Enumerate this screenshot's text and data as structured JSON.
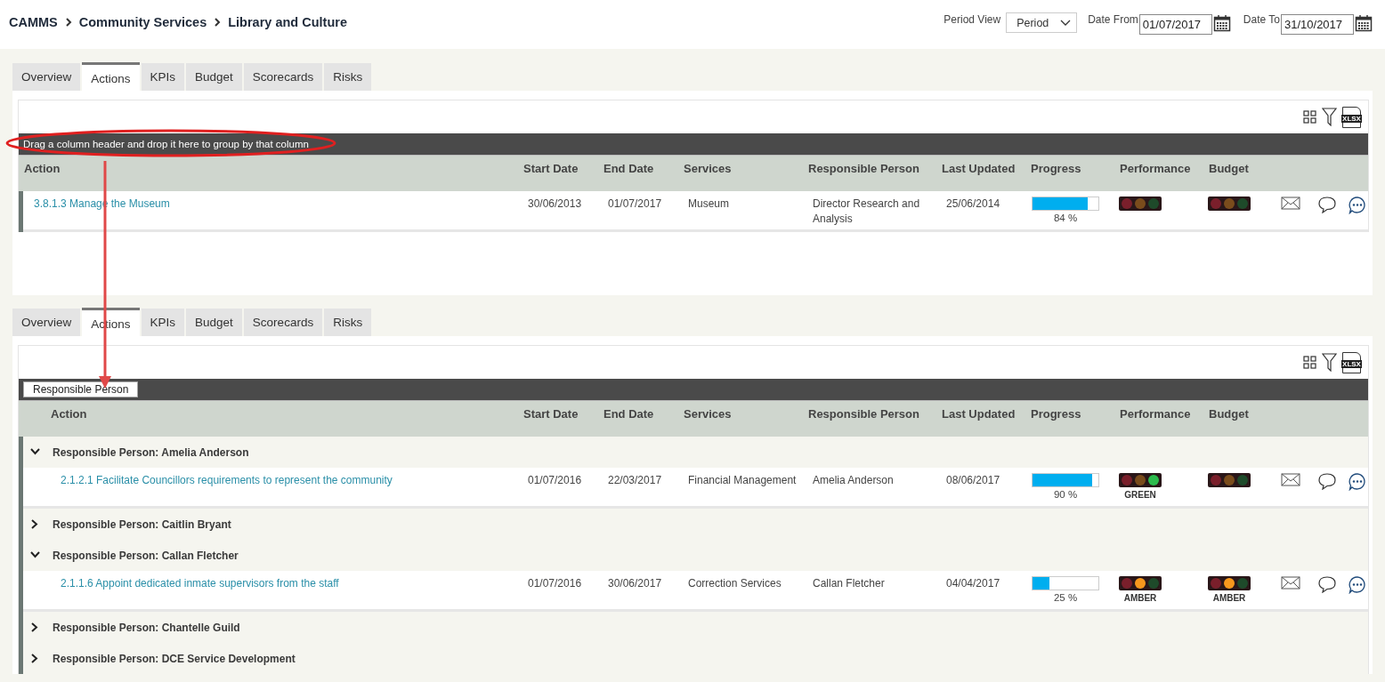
{
  "breadcrumb": [
    "CAMMS",
    "Community Services",
    "Library and Culture"
  ],
  "filters": {
    "period_view": {
      "label": "Period View",
      "value": "Period"
    },
    "date_from": {
      "label": "Date From",
      "value": "01/07/2017"
    },
    "date_to": {
      "label": "Date To",
      "value": "31/10/2017"
    }
  },
  "panels": [
    {
      "tabs": [
        {
          "label": "Overview",
          "selected": false
        },
        {
          "label": "Actions",
          "selected": true
        },
        {
          "label": "KPIs",
          "selected": false
        },
        {
          "label": "Budget",
          "selected": false
        },
        {
          "label": "Scorecards",
          "selected": false
        },
        {
          "label": "Risks",
          "selected": false
        }
      ],
      "export_label": "XLSX",
      "group_bar": {
        "kind": "hint",
        "text": "Drag a column header and drop it here to group by that column"
      },
      "columns": [
        "Action",
        "Start Date",
        "End Date",
        "Services",
        "Responsible Person",
        "Last Updated",
        "Progress",
        "Performance",
        "Budget"
      ],
      "rows": [
        {
          "action": "3.8.1.3 Manage the Museum",
          "start_date": "30/06/2013",
          "end_date": "01/07/2017",
          "service": "Museum",
          "responsible_person": "Director Research and Analysis",
          "last_updated": "25/06/2014",
          "progress": {
            "level": 0.84,
            "reading": "84 %"
          },
          "performance": {
            "lit": {
              "red": false,
              "amber": false,
              "green": false
            }
          },
          "budget": {
            "lit": {
              "red": false,
              "amber": false,
              "green": false
            }
          }
        }
      ]
    },
    {
      "tabs": [
        {
          "label": "Overview",
          "selected": false
        },
        {
          "label": "Actions",
          "selected": true
        },
        {
          "label": "KPIs",
          "selected": false
        },
        {
          "label": "Budget",
          "selected": false
        },
        {
          "label": "Scorecards",
          "selected": false
        },
        {
          "label": "Risks",
          "selected": false
        }
      ],
      "export_label": "XLSX",
      "group_bar": {
        "kind": "chips",
        "chips": [
          "Responsible Person"
        ]
      },
      "columns": [
        "Action",
        "Start Date",
        "End Date",
        "Services",
        "Responsible Person",
        "Last Updated",
        "Progress",
        "Performance",
        "Budget"
      ],
      "groups": [
        {
          "label": "Responsible Person: Amelia Anderson",
          "expanded": true,
          "children": [
            {
              "action": "2.1.2.1 Facilitate Councillors requirements to represent the community",
              "start_date": "01/07/2016",
              "end_date": "22/03/2017",
              "service": "Financial Management",
              "responsible_person": "Amelia Anderson",
              "last_updated": "08/06/2017",
              "progress": {
                "level": 0.9,
                "reading": "90 %"
              },
              "performance": {
                "lit": {
                  "red": false,
                  "amber": false,
                  "green": true
                },
                "label": "GREEN"
              },
              "budget": {
                "lit": {
                  "red": false,
                  "amber": false,
                  "green": false
                }
              }
            }
          ]
        },
        {
          "label": "Responsible Person: Caitlin Bryant",
          "expanded": false
        },
        {
          "label": "Responsible Person: Callan Fletcher",
          "expanded": true,
          "children": [
            {
              "action": "2.1.1.6 Appoint dedicated inmate supervisors from the staff",
              "start_date": "01/07/2016",
              "end_date": "30/06/2017",
              "service": "Correction Services",
              "responsible_person": "Callan Fletcher",
              "last_updated": "04/04/2017",
              "progress": {
                "level": 0.25,
                "reading": "25 %"
              },
              "performance": {
                "lit": {
                  "red": false,
                  "amber": true,
                  "green": false
                },
                "label": "AMBER"
              },
              "budget": {
                "lit": {
                  "red": false,
                  "amber": true,
                  "green": false
                },
                "label": "AMBER"
              }
            }
          ]
        },
        {
          "label": "Responsible Person: Chantelle Guild",
          "expanded": false
        },
        {
          "label": "Responsible Person: DCE Service Development",
          "expanded": false
        }
      ]
    }
  ]
}
